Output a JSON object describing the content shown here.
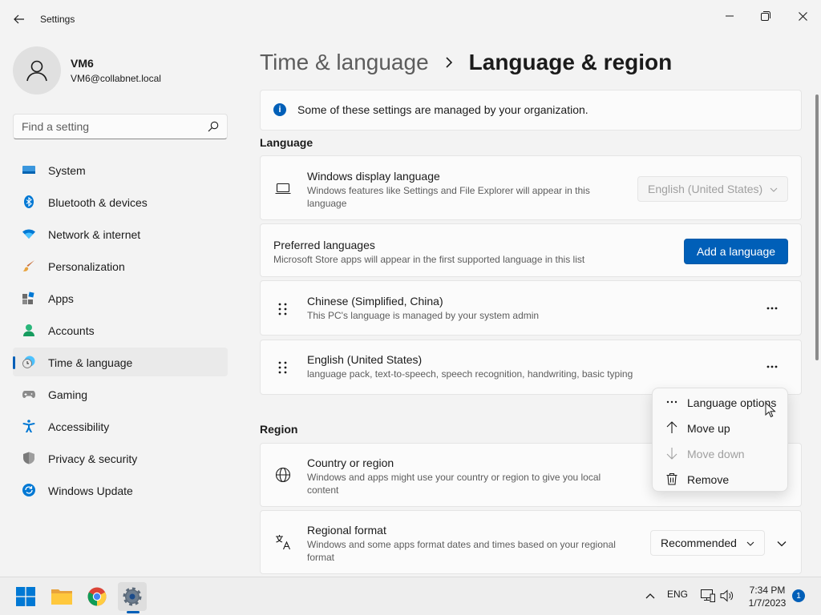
{
  "window": {
    "app_title": "Settings",
    "back_icon": "back-arrow-icon",
    "controls": [
      "minimize-icon",
      "maximize-icon",
      "close-icon"
    ]
  },
  "profile": {
    "name": "VM6",
    "email": "VM6@collabnet.local",
    "avatar_icon": "person-icon"
  },
  "search": {
    "placeholder": "Find a setting",
    "icon": "search-icon"
  },
  "sidebar": {
    "items": [
      {
        "label": "System",
        "icon": "system-icon"
      },
      {
        "label": "Bluetooth & devices",
        "icon": "bluetooth-icon"
      },
      {
        "label": "Network & internet",
        "icon": "wifi-icon"
      },
      {
        "label": "Personalization",
        "icon": "brush-icon"
      },
      {
        "label": "Apps",
        "icon": "apps-icon"
      },
      {
        "label": "Accounts",
        "icon": "accounts-icon"
      },
      {
        "label": "Time & language",
        "icon": "time-language-icon",
        "selected": true
      },
      {
        "label": "Gaming",
        "icon": "gamepad-icon"
      },
      {
        "label": "Accessibility",
        "icon": "accessibility-icon"
      },
      {
        "label": "Privacy & security",
        "icon": "shield-icon"
      },
      {
        "label": "Windows Update",
        "icon": "update-icon"
      }
    ]
  },
  "breadcrumb": {
    "parent": "Time & language",
    "current": "Language & region"
  },
  "info_banner": {
    "text": "Some of these settings are managed by your organization."
  },
  "language_section": {
    "title": "Language",
    "display_language": {
      "title": "Windows display language",
      "description": "Windows features like Settings and File Explorer will appear in this language",
      "value": "English (United States)"
    },
    "preferred": {
      "title": "Preferred languages",
      "description": "Microsoft Store apps will appear in the first supported language in this list",
      "add_button": "Add a language"
    },
    "languages": [
      {
        "title": "Chinese (Simplified, China)",
        "description": "This PC's language is managed by your system admin"
      },
      {
        "title": "English (United States)",
        "description": "language pack, text-to-speech, speech recognition, handwriting, basic typing"
      }
    ]
  },
  "context_menu": {
    "items": [
      {
        "label": "Language options",
        "icon": "more-icon",
        "enabled": true
      },
      {
        "label": "Move up",
        "icon": "arrow-up-icon",
        "enabled": true
      },
      {
        "label": "Move down",
        "icon": "arrow-down-icon",
        "enabled": false
      },
      {
        "label": "Remove",
        "icon": "trash-icon",
        "enabled": true
      }
    ]
  },
  "region_section": {
    "title": "Region",
    "country": {
      "title": "Country or region",
      "description": "Windows and apps might use your country or region to give you local content"
    },
    "format": {
      "title": "Regional format",
      "description": "Windows and some apps format dates and times based on your regional format",
      "value": "Recommended"
    }
  },
  "taskbar": {
    "apps": [
      "start-icon",
      "file-explorer-icon",
      "chrome-icon",
      "settings-gear-icon"
    ],
    "language": "ENG",
    "time": "7:34 PM",
    "date": "1/7/2023",
    "notification_count": "1"
  },
  "colors": {
    "accent": "#005fb8",
    "background": "#f3f3f3",
    "card": "#fbfbfb"
  }
}
